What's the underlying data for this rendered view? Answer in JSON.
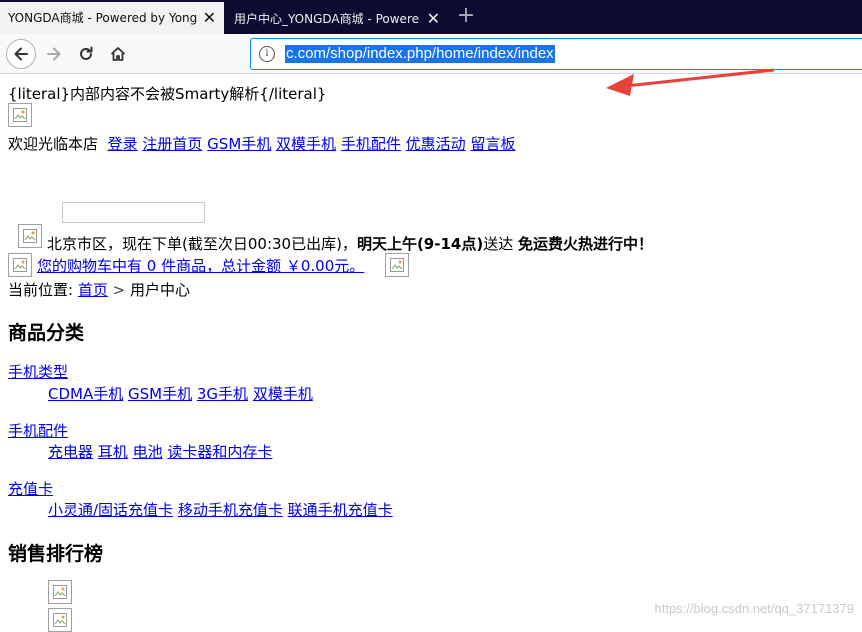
{
  "browser": {
    "tabs": [
      {
        "title": "YONGDA商城 - Powered by Yong",
        "active": true
      },
      {
        "title": "用户中心_YONGDA商城 - Powere",
        "active": false
      }
    ],
    "url": "c.com/shop/index.php/home/index/index"
  },
  "page": {
    "literal_note": "{literal}内部内容不会被Smarty解析{/literal}",
    "welcome": "欢迎光临本店",
    "top_links": [
      "登录",
      "注册",
      "首页",
      "GSM手机",
      "双模手机",
      "手机配件",
      "优惠活动",
      "留言板"
    ],
    "delivery": {
      "prefix": "北京市区，现在下单(截至次日00:30已出库)，",
      "bold1": "明天上午(9-14点)",
      "mid": "送达 ",
      "bold2": "免运费火热进行中！"
    },
    "cart": "您的购物车中有 0 件商品，总计金额 ￥0.00元。",
    "breadcrumb": {
      "label": "当前位置:",
      "home": "首页",
      "sep": ">",
      "current": "用户中心"
    },
    "category_title": "商品分类",
    "categories": [
      {
        "name": "手机类型",
        "items": [
          "CDMA手机",
          "GSM手机",
          "3G手机",
          "双模手机"
        ]
      },
      {
        "name": "手机配件",
        "items": [
          "充电器",
          "耳机",
          "电池",
          "读卡器和内存卡"
        ]
      },
      {
        "name": "充值卡",
        "items": [
          "小灵通/固话充值卡",
          "移动手机充值卡",
          "联通手机充值卡"
        ]
      }
    ],
    "ranking_title": "销售排行榜",
    "watermark": "https://blog.csdn.net/qq_37171379"
  },
  "colors": {
    "link": "#0000ee",
    "tabstrip": "#0c0c32",
    "url_highlight": "#1a73e8",
    "annotation": "#e8403a"
  }
}
